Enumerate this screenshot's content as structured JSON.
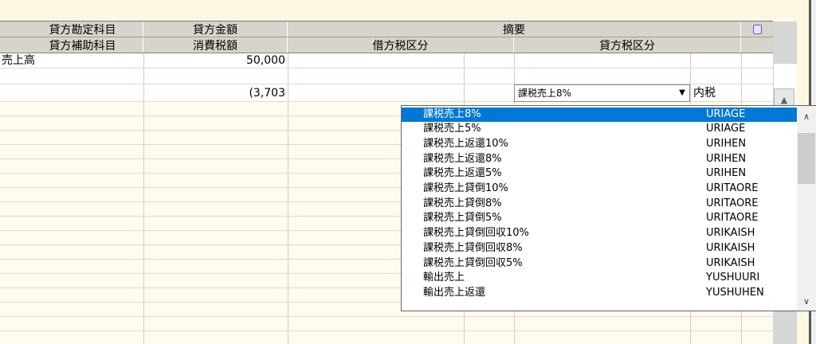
{
  "header": {
    "row1": {
      "credit_account": "貸方勘定科目",
      "credit_amount": "貸方金額",
      "summary": "摘要"
    },
    "row2": {
      "credit_sub_account": "貸方補助科目",
      "consumption_tax": "消費税額",
      "debit_tax_category": "借方税区分",
      "credit_tax_category": "貸方税区分"
    }
  },
  "grid": {
    "row1": {
      "account": "売上高",
      "amount": "50,000"
    },
    "row2": {
      "tax_amount": "(3,703",
      "tax_category_value": "課税売上8%",
      "tax_method": "内税"
    }
  },
  "dropdown": {
    "items": [
      {
        "name": "課税売上8%",
        "code": "URIAGE"
      },
      {
        "name": "課税売上5%",
        "code": "URIAGE"
      },
      {
        "name": "課税売上返還10%",
        "code": "URIHEN"
      },
      {
        "name": "課税売上返還8%",
        "code": "URIHEN"
      },
      {
        "name": "課税売上返還5%",
        "code": "URIHEN"
      },
      {
        "name": "課税売上貸倒10%",
        "code": "URITAORE"
      },
      {
        "name": "課税売上貸倒8%",
        "code": "URITAORE"
      },
      {
        "name": "課税売上貸倒5%",
        "code": "URITAORE"
      },
      {
        "name": "課税売上貸倒回収10%",
        "code": "URIKAISH"
      },
      {
        "name": "課税売上貸倒回収8%",
        "code": "URIKAISH"
      },
      {
        "name": "課税売上貸倒回収5%",
        "code": "URIKAISH"
      },
      {
        "name": "輸出売上",
        "code": "YUSHUURI"
      },
      {
        "name": "輸出売上返還",
        "code": "YUSHUHEN"
      }
    ],
    "selected_index": 0
  },
  "colors": {
    "selection": "#0078d7",
    "header_bg": "#d8d4cb",
    "grid_bg": "#fffbee"
  }
}
